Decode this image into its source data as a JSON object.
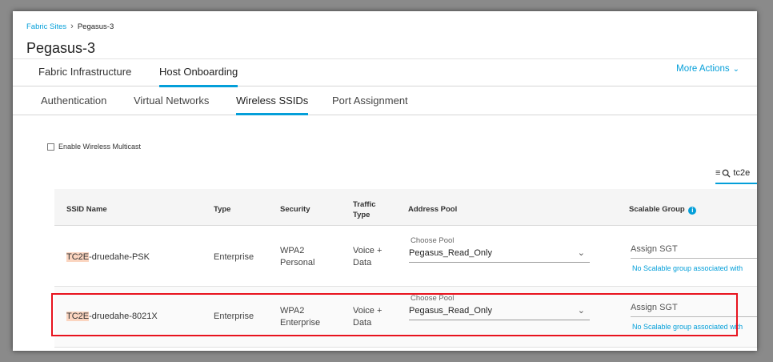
{
  "breadcrumb": {
    "parent": "Fabric Sites",
    "current": "Pegasus-3"
  },
  "page_title": "Pegasus-3",
  "top_tabs": [
    {
      "label": "Fabric Infrastructure",
      "active": false
    },
    {
      "label": "Host Onboarding",
      "active": true
    }
  ],
  "more_actions": "More Actions",
  "sub_tabs": [
    {
      "label": "Authentication",
      "active": false
    },
    {
      "label": "Virtual Networks",
      "active": false
    },
    {
      "label": "Wireless SSIDs",
      "active": true
    },
    {
      "label": "Port Assignment",
      "active": false
    }
  ],
  "multicast": {
    "label": "Enable Wireless Multicast",
    "checked": false
  },
  "search": {
    "value": "tc2e"
  },
  "table": {
    "headers": {
      "ssid_name": "SSID Name",
      "type": "Type",
      "security": "Security",
      "traffic_type_1": "Traffic",
      "traffic_type_2": "Type",
      "address_pool": "Address Pool",
      "scalable_group": "Scalable Group"
    },
    "rows": [
      {
        "ssid_prefix": "TC2E",
        "ssid_suffix": "-druedahe-PSK",
        "type": "Enterprise",
        "security_1": "WPA2",
        "security_2": "Personal",
        "traffic_1": "Voice +",
        "traffic_2": "Data",
        "pool_label": "Choose Pool",
        "pool_value": "Pegasus_Read_Only",
        "sgt_placeholder": "Assign SGT",
        "sgt_note": "No Scalable group associated with"
      },
      {
        "ssid_prefix": "TC2E",
        "ssid_suffix": "-druedahe-8021X",
        "type": "Enterprise",
        "security_1": "WPA2",
        "security_2": "Enterprise",
        "traffic_1": "Voice +",
        "traffic_2": "Data",
        "pool_label": "Choose Pool",
        "pool_value": "Pegasus_Read_Only",
        "sgt_placeholder": "Assign SGT",
        "sgt_note": "No Scalable group associated with"
      }
    ]
  },
  "colors": {
    "accent": "#049fd9",
    "highlight_box": "#e8131e",
    "search_highlight": "#fbd5c0"
  }
}
